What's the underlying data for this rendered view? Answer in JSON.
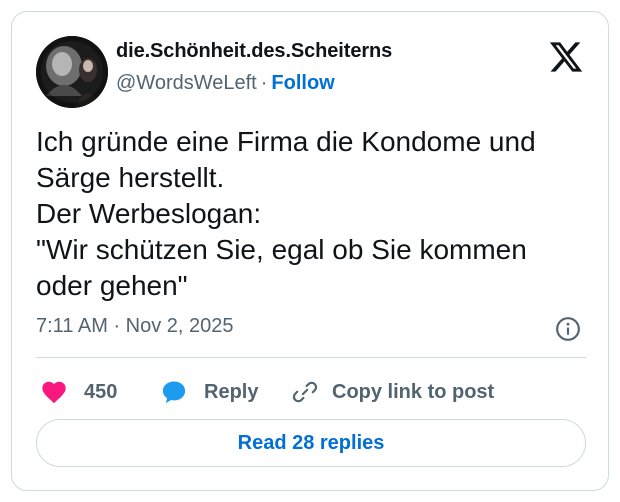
{
  "author": {
    "display_name": "die.Schönheit.des.Scheiterns",
    "handle": "@WordsWeLeft",
    "separator": "·",
    "follow_label": "Follow"
  },
  "icons": {
    "logo": "x-logo-icon",
    "info": "info-icon",
    "like": "heart-icon",
    "reply": "speech-bubble-icon",
    "copy": "link-icon"
  },
  "tweet": {
    "lines": [
      "Ich gründe eine Firma die Kondome und",
      "Särge herstellt.",
      "Der Werbeslogan:",
      "\"Wir schützen Sie, egal ob Sie kommen",
      "oder gehen\""
    ],
    "timestamp": "7:11 AM · Nov 2, 2025"
  },
  "actions": {
    "like_count": "450",
    "reply_label": "Reply",
    "copy_label": "Copy link to post"
  },
  "footer": {
    "read_replies_label": "Read 28 replies"
  },
  "colors": {
    "accent": "#006fd6",
    "like": "#f91880",
    "reply": "#1d9bf0",
    "muted": "#536471",
    "border": "#cfd9de",
    "text": "#0f1419"
  }
}
